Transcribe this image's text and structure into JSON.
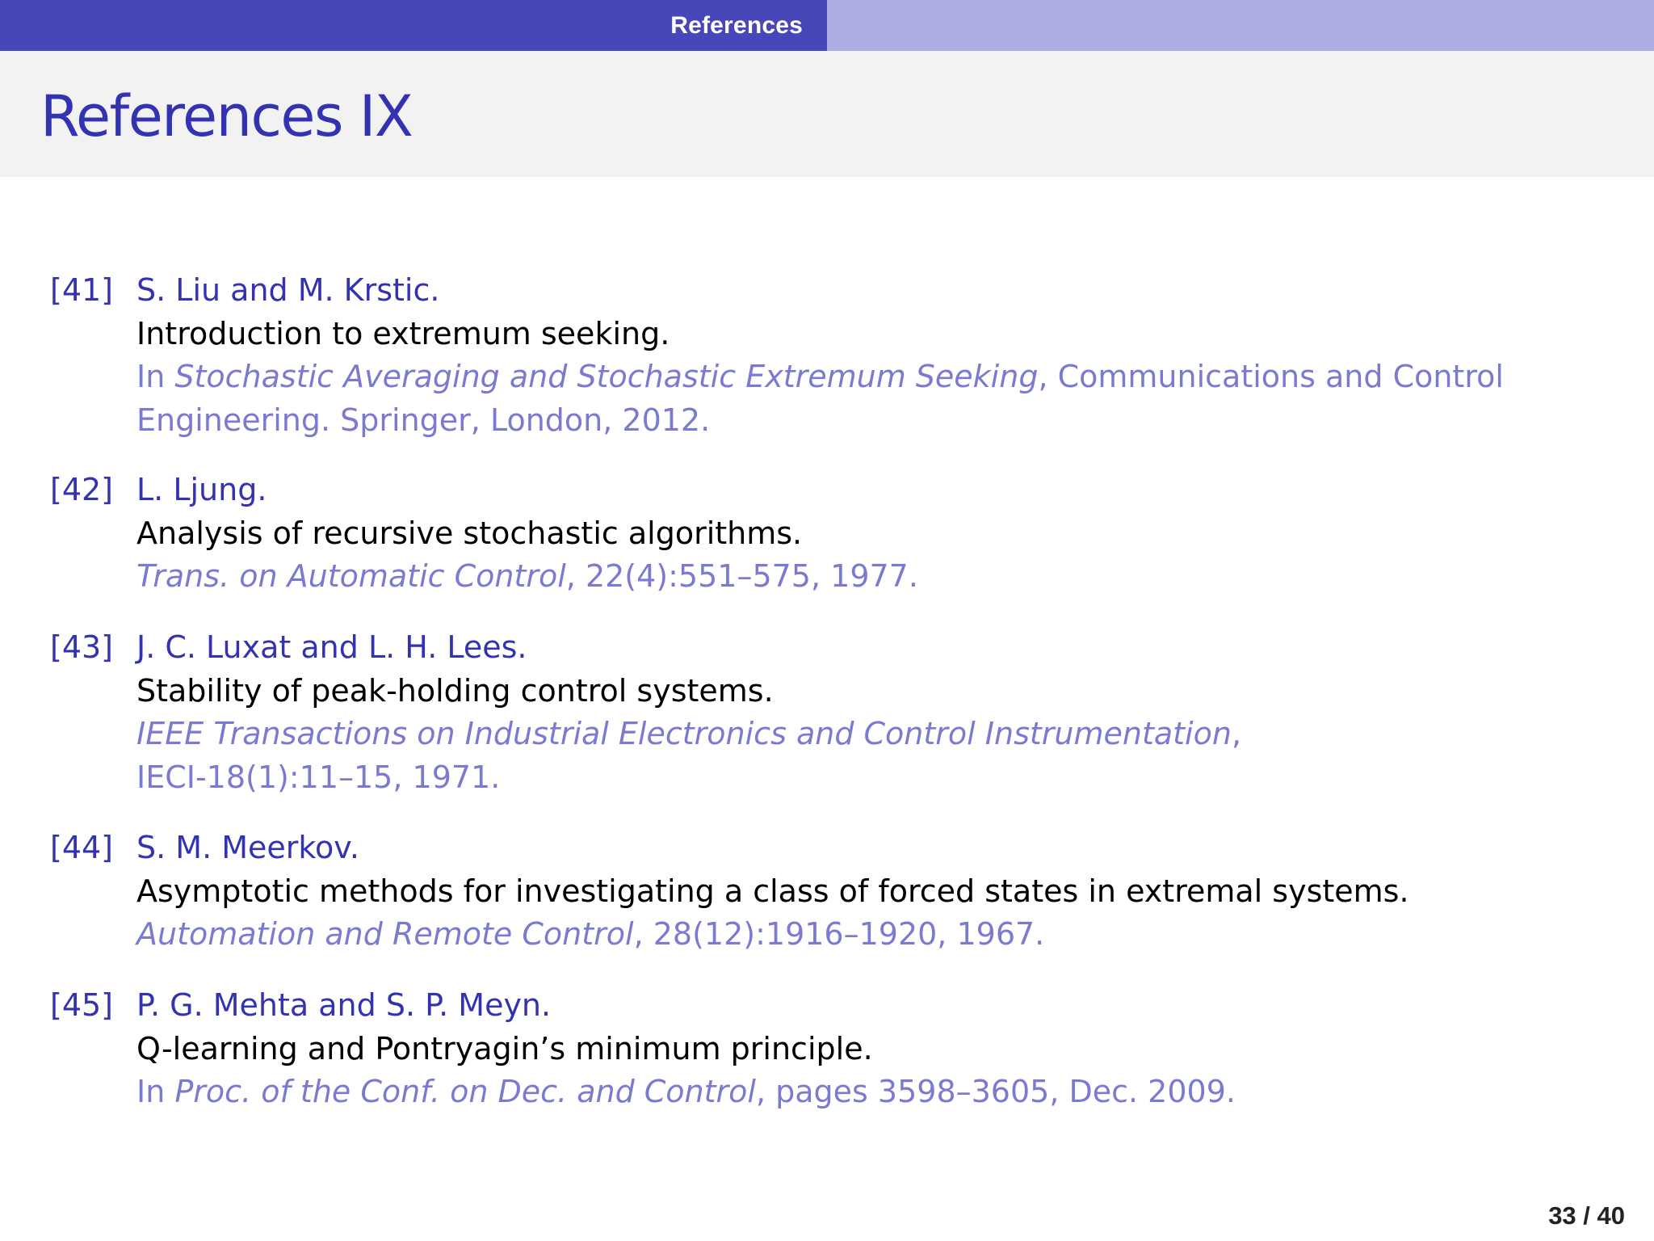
{
  "header": {
    "section": "References"
  },
  "title": "References IX",
  "references": [
    {
      "number": "[41]",
      "authors": "S. Liu and M. Krstic.",
      "title": "Introduction to extremum seeking.",
      "venue_prefix": "In ",
      "venue_italic": "Stochastic Averaging and Stochastic Extremum Seeking",
      "venue_suffix": ", Communications and Control",
      "venue_line2": "Engineering. Springer, London, 2012."
    },
    {
      "number": "[42]",
      "authors": "L. Ljung.",
      "title": "Analysis of recursive stochastic algorithms.",
      "venue_prefix": "",
      "venue_italic": "Trans. on Automatic Control",
      "venue_suffix": ", 22(4):551–575, 1977.",
      "venue_line2": ""
    },
    {
      "number": "[43]",
      "authors": "J. C. Luxat and L. H. Lees.",
      "title": "Stability of peak-holding control systems.",
      "venue_prefix": "",
      "venue_italic": "IEEE Transactions on Industrial Electronics and Control Instrumentation",
      "venue_suffix": ",",
      "venue_line2": "IECI-18(1):11–15, 1971."
    },
    {
      "number": "[44]",
      "authors": "S. M. Meerkov.",
      "title": "Asymptotic methods for investigating a class of forced states in extremal systems.",
      "venue_prefix": "",
      "venue_italic": "Automation and Remote Control",
      "venue_suffix": ", 28(12):1916–1920, 1967.",
      "venue_line2": ""
    },
    {
      "number": "[45]",
      "authors": "P. G. Mehta and S. P. Meyn.",
      "title": "Q-learning and Pontryagin’s minimum principle.",
      "venue_prefix": "In ",
      "venue_italic": "Proc. of the Conf. on Dec. and Control",
      "venue_suffix": ", pages 3598–3605, Dec. 2009.",
      "venue_line2": ""
    }
  ],
  "footer": {
    "page": "33 / 40"
  }
}
